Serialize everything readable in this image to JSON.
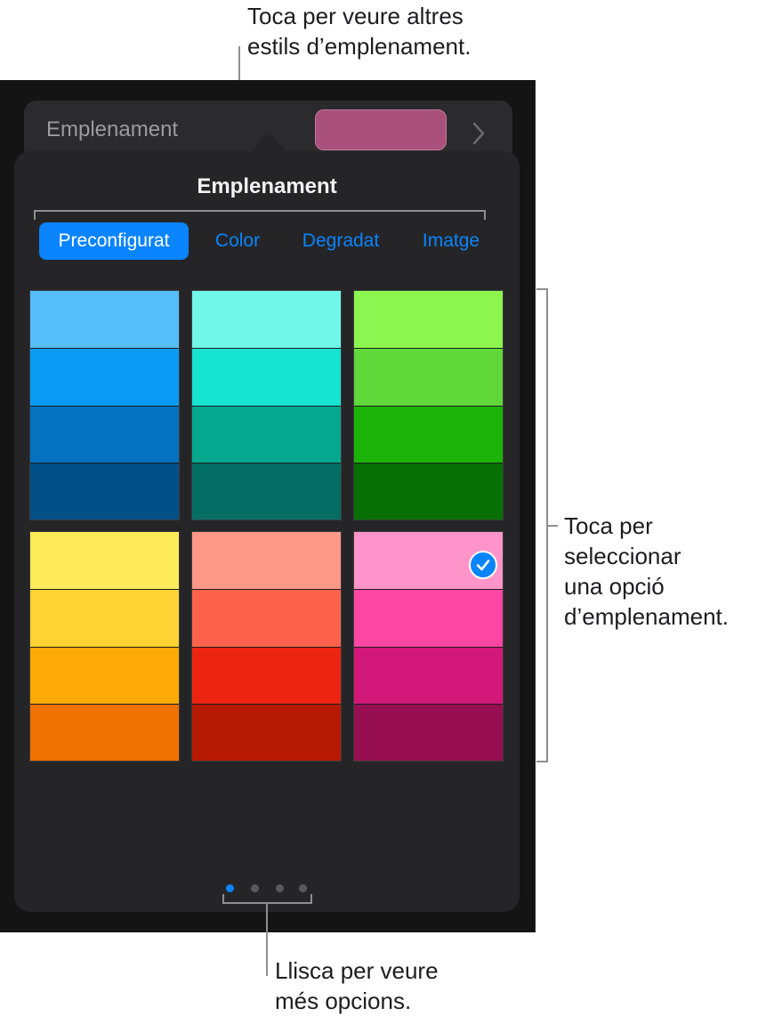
{
  "callouts": {
    "top_line1": "Toca per veure altres",
    "top_line2": "estils d’emplenament.",
    "right_line1": "Toca per",
    "right_line2": "seleccionar",
    "right_line3": "una opció",
    "right_line4": "d’emplenament.",
    "bottom_line1": "Llisca per veure",
    "bottom_line2": "més opcions."
  },
  "fill_row": {
    "label": "Emplenament",
    "current_color": "#a9517a"
  },
  "popover": {
    "title": "Emplenament",
    "tabs": [
      {
        "label": "Preconfigurat",
        "active": true
      },
      {
        "label": "Color",
        "active": false
      },
      {
        "label": "Degradat",
        "active": false
      },
      {
        "label": "Imatge",
        "active": false
      }
    ],
    "swatches": [
      {
        "name": "blue",
        "colors": [
          "#56bdfb",
          "#0a9cf5",
          "#0572bf",
          "#034f87"
        ],
        "selected": false
      },
      {
        "name": "teal",
        "colors": [
          "#70f7e7",
          "#16e3d0",
          "#05a88f",
          "#046e65"
        ],
        "selected": false
      },
      {
        "name": "green",
        "colors": [
          "#8cf54f",
          "#60d83a",
          "#1cb309",
          "#067005"
        ],
        "selected": false
      },
      {
        "name": "yellow",
        "colors": [
          "#fdeb5a",
          "#fed333",
          "#fdaa06",
          "#ef7202"
        ],
        "selected": false
      },
      {
        "name": "red",
        "colors": [
          "#fe9887",
          "#fe624c",
          "#ed2410",
          "#b61904"
        ],
        "selected": false
      },
      {
        "name": "pink",
        "colors": [
          "#fe94ca",
          "#fc46a3",
          "#d21879",
          "#970f51"
        ],
        "selected": true
      }
    ],
    "page_count": 4,
    "current_page": 0
  }
}
